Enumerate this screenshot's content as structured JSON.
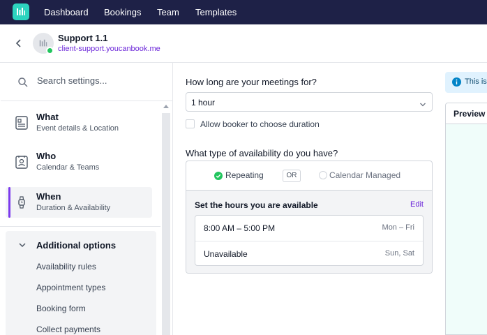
{
  "colors": {
    "nav_bg": "#1e2147",
    "brand": "#2dd4bf",
    "accent": "#7c3aed",
    "link": "#6d28d9",
    "status_online": "#22c55e"
  },
  "topnav": {
    "logo_icon": "calendar-bars-icon",
    "items": [
      "Dashboard",
      "Bookings",
      "Team",
      "Templates"
    ]
  },
  "header": {
    "back_icon": "chevron-left-icon",
    "title": "Support 1.1",
    "subtitle": "client-support.youcanbook.me"
  },
  "sidebar": {
    "search_placeholder": "Search settings...",
    "menu": [
      {
        "title": "What",
        "sub": "Event details & Location",
        "icon": "document-icon"
      },
      {
        "title": "Who",
        "sub": "Calendar & Teams",
        "icon": "person-card-icon"
      },
      {
        "title": "When",
        "sub": "Duration & Availability",
        "icon": "watch-icon",
        "active": true
      }
    ],
    "additional": {
      "title": "Additional options",
      "links": [
        "Availability rules",
        "Appointment types",
        "Booking form",
        "Collect payments"
      ]
    }
  },
  "main": {
    "duration_label": "How long are your meetings for?",
    "duration_value": "1 hour",
    "allow_choose_label": "Allow booker to choose duration",
    "availability_label": "What type of availability do you have?",
    "tab_repeating": "Repeating",
    "or_label": "OR",
    "tab_calendar": "Calendar Managed",
    "hours_title": "Set the hours you are available",
    "edit_label": "Edit",
    "hours": [
      {
        "time": "8:00 AM – 5:00 PM",
        "days": "Mon – Fri"
      },
      {
        "time": "Unavailable",
        "days": "Sun, Sat"
      }
    ]
  },
  "preview": {
    "info_text": "This is",
    "title": "Preview"
  }
}
